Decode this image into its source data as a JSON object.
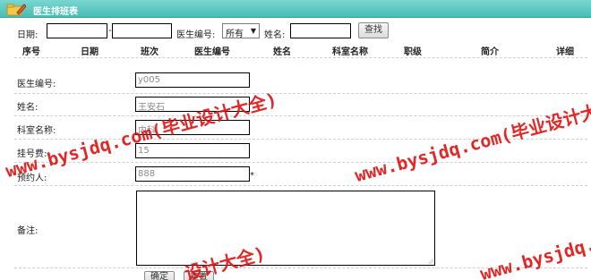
{
  "header": {
    "title": "医生排班表",
    "icon": "folder-pencil-icon"
  },
  "filter": {
    "date_label": "日期:",
    "date_from_value": "",
    "date_separator": "-",
    "date_to_value": "",
    "doctor_id_label": "医生编号:",
    "doctor_id_select": "所有",
    "name_label": "姓名:",
    "name_value": "",
    "search_button": "查找"
  },
  "table": {
    "columns": [
      "序号",
      "日期",
      "班次",
      "医生编号",
      "姓名",
      "科室名称",
      "职级",
      "简介",
      "详细"
    ]
  },
  "form": {
    "fields": [
      {
        "label": "医生编号:",
        "value": "y005"
      },
      {
        "label": "姓名:",
        "value": "王安石"
      },
      {
        "label": "科室名称:",
        "value": "内科"
      },
      {
        "label": "挂号费:",
        "value": "15"
      },
      {
        "label": "预约人:",
        "value": "888",
        "required_mark": "*"
      }
    ],
    "remark_label": "备注:",
    "remark_value": "",
    "submit_button": "确定",
    "reset_button": "重置"
  },
  "watermark": {
    "text1": "www.bysjdq.com(毕业设计大全)",
    "text2": "www.bysjdq.com(毕业设计大全)",
    "text3": "设计大全)",
    "text4": "www.bysjdq.com(毕业设计大全)",
    "color": "#e01010"
  }
}
